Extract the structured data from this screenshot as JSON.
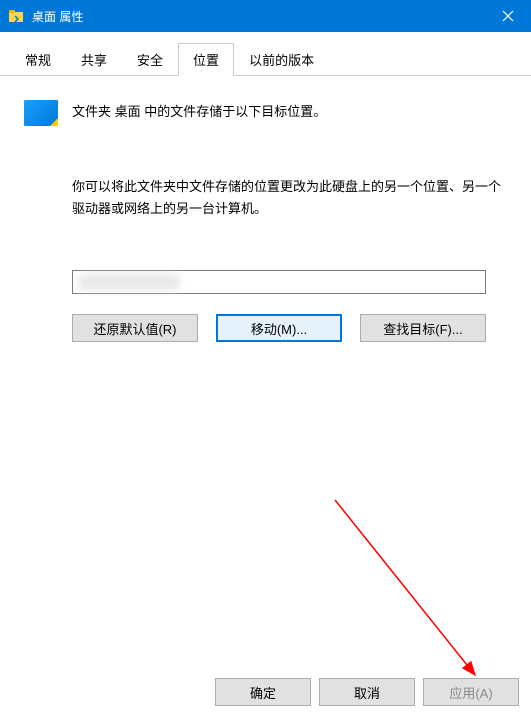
{
  "titlebar": {
    "title": "桌面 属性"
  },
  "tabs": {
    "items": [
      {
        "label": "常规"
      },
      {
        "label": "共享"
      },
      {
        "label": "安全"
      },
      {
        "label": "位置"
      },
      {
        "label": "以前的版本"
      }
    ]
  },
  "content": {
    "description": "文件夹 桌面 中的文件存储于以下目标位置。",
    "info": "你可以将此文件夹中文件存储的位置更改为此硬盘上的另一个位置、另一个驱动器或网络上的另一台计算机。",
    "path_value": ""
  },
  "buttons": {
    "restore": "还原默认值(R)",
    "move": "移动(M)...",
    "find_target": "查找目标(F)..."
  },
  "bottom": {
    "ok": "确定",
    "cancel": "取消",
    "apply": "应用(A)"
  }
}
